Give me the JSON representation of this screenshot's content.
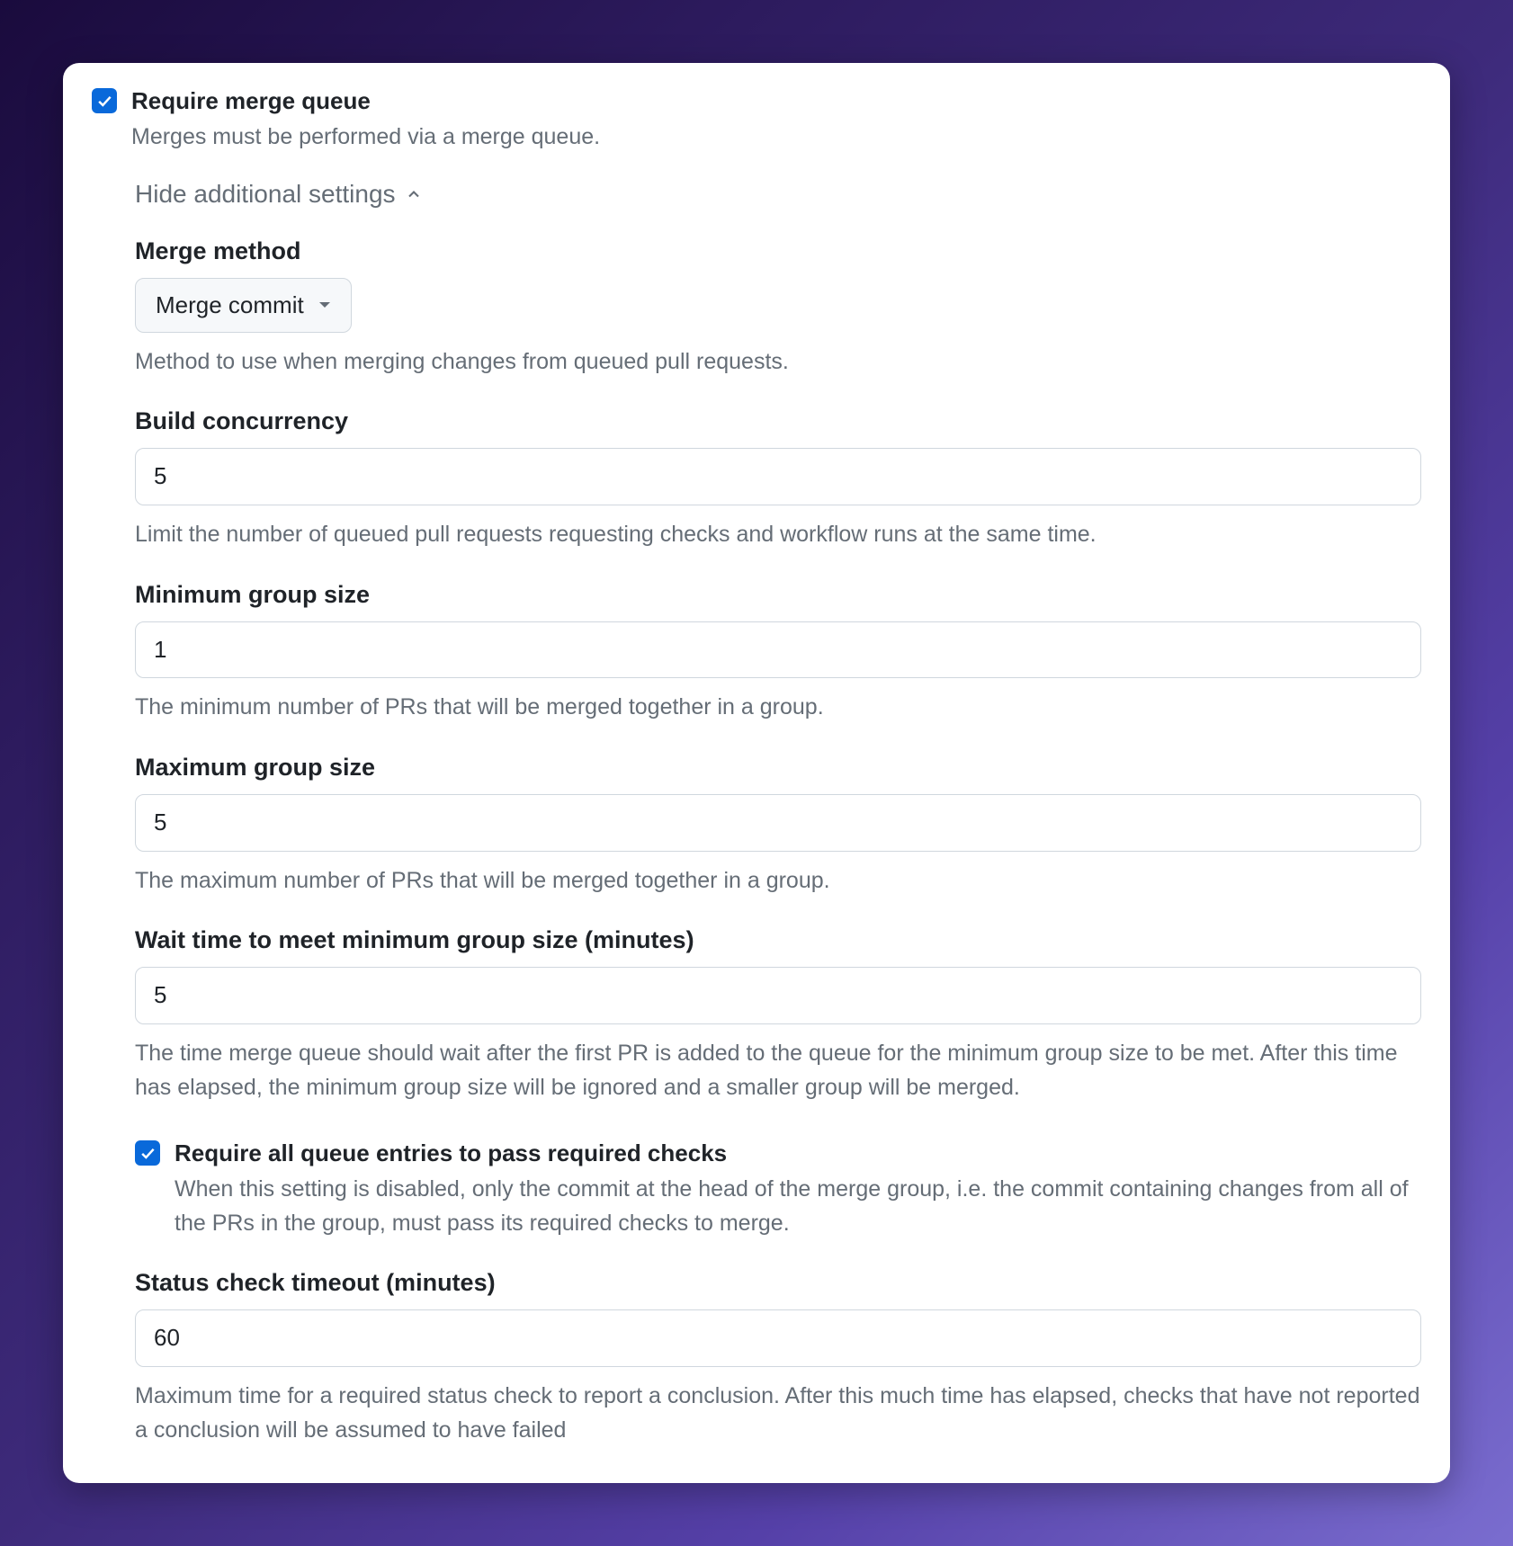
{
  "requireMergeQueue": {
    "title": "Require merge queue",
    "description": "Merges must be performed via a merge queue."
  },
  "toggleLabel": "Hide additional settings",
  "mergeMethod": {
    "label": "Merge method",
    "value": "Merge commit",
    "help": "Method to use when merging changes from queued pull requests."
  },
  "buildConcurrency": {
    "label": "Build concurrency",
    "value": "5",
    "help": "Limit the number of queued pull requests requesting checks and workflow runs at the same time."
  },
  "minGroupSize": {
    "label": "Minimum group size",
    "value": "1",
    "help": "The minimum number of PRs that will be merged together in a group."
  },
  "maxGroupSize": {
    "label": "Maximum group size",
    "value": "5",
    "help": "The maximum number of PRs that will be merged together in a group."
  },
  "waitTime": {
    "label": "Wait time to meet minimum group size (minutes)",
    "value": "5",
    "help": "The time merge queue should wait after the first PR is added to the queue for the minimum group size to be met. After this time has elapsed, the minimum group size will be ignored and a smaller group will be merged."
  },
  "requireAllChecks": {
    "title": "Require all queue entries to pass required checks",
    "description": "When this setting is disabled, only the commit at the head of the merge group, i.e. the commit containing changes from all of the PRs in the group, must pass its required checks to merge."
  },
  "statusTimeout": {
    "label": "Status check timeout (minutes)",
    "value": "60",
    "help": "Maximum time for a required status check to report a conclusion. After this much time has elapsed, checks that have not reported a conclusion will be assumed to have failed"
  }
}
